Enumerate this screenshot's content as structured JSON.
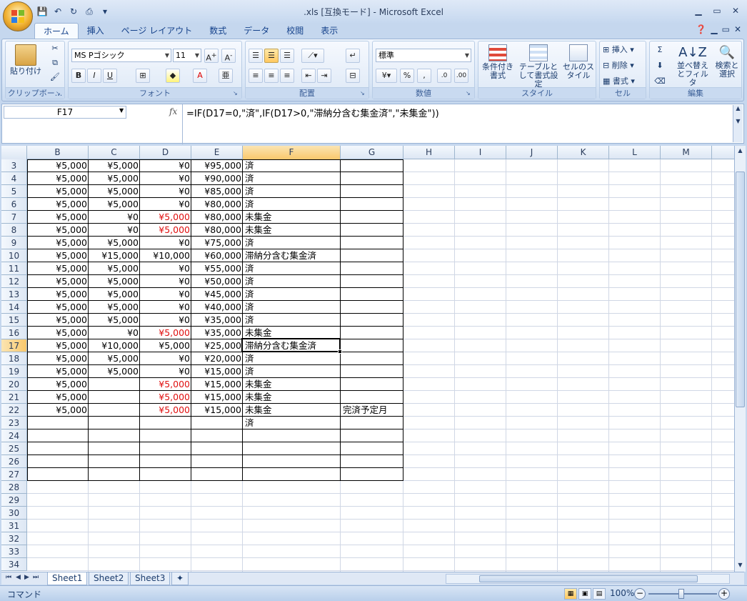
{
  "app": {
    "title": ".xls [互換モード] - Microsoft Excel"
  },
  "ribbon_tabs": [
    "ホーム",
    "挿入",
    "ページ レイアウト",
    "数式",
    "データ",
    "校閲",
    "表示"
  ],
  "groups": {
    "clipboard": {
      "label": "クリップボー...",
      "paste": "貼り付け"
    },
    "font": {
      "label": "フォント",
      "font_name": "MS Pゴシック",
      "font_size": "11"
    },
    "alignment": {
      "label": "配置"
    },
    "number": {
      "label": "数値",
      "format": "標準"
    },
    "style": {
      "label": "スタイル",
      "conditional": "条件付き書式",
      "table": "テーブルとして書式設定",
      "cell_style": "セルのスタイル"
    },
    "cells": {
      "label": "セル",
      "insert": "挿入",
      "delete": "削除",
      "format": "書式"
    },
    "editing": {
      "label": "編集",
      "sort": "並べ替えとフィルタ",
      "find": "検索と選択"
    }
  },
  "formula_bar": {
    "name_box": "F17",
    "formula": "=IF(D17=0,\"済\",IF(D17>0,\"滞納分含む集金済\",\"未集金\"))"
  },
  "columns": [
    "B",
    "C",
    "D",
    "E",
    "F",
    "G",
    "H",
    "I",
    "J",
    "K",
    "L",
    "M"
  ],
  "rows": [
    3,
    4,
    5,
    6,
    7,
    8,
    9,
    10,
    11,
    12,
    13,
    14,
    15,
    16,
    17,
    18,
    19,
    20,
    21,
    22,
    23,
    24,
    25,
    26,
    27,
    28,
    29,
    30,
    31,
    32,
    33,
    34
  ],
  "table": [
    {
      "B": "¥5,000",
      "C": "¥5,000",
      "D": "¥0",
      "E": "¥95,000",
      "F": "済",
      "G": ""
    },
    {
      "B": "¥5,000",
      "C": "¥5,000",
      "D": "¥0",
      "E": "¥90,000",
      "F": "済",
      "G": ""
    },
    {
      "B": "¥5,000",
      "C": "¥5,000",
      "D": "¥0",
      "E": "¥85,000",
      "F": "済",
      "G": ""
    },
    {
      "B": "¥5,000",
      "C": "¥5,000",
      "D": "¥0",
      "E": "¥80,000",
      "F": "済",
      "G": ""
    },
    {
      "B": "¥5,000",
      "C": "¥0",
      "D": "¥5,000",
      "E": "¥80,000",
      "F": "未集金",
      "G": "",
      "Dred": true
    },
    {
      "B": "¥5,000",
      "C": "¥0",
      "D": "¥5,000",
      "E": "¥80,000",
      "F": "未集金",
      "G": "",
      "Dred": true
    },
    {
      "B": "¥5,000",
      "C": "¥5,000",
      "D": "¥0",
      "E": "¥75,000",
      "F": "済",
      "G": ""
    },
    {
      "B": "¥5,000",
      "C": "¥15,000",
      "D": "¥10,000",
      "E": "¥60,000",
      "F": "滞納分含む集金済",
      "G": ""
    },
    {
      "B": "¥5,000",
      "C": "¥5,000",
      "D": "¥0",
      "E": "¥55,000",
      "F": "済",
      "G": ""
    },
    {
      "B": "¥5,000",
      "C": "¥5,000",
      "D": "¥0",
      "E": "¥50,000",
      "F": "済",
      "G": ""
    },
    {
      "B": "¥5,000",
      "C": "¥5,000",
      "D": "¥0",
      "E": "¥45,000",
      "F": "済",
      "G": ""
    },
    {
      "B": "¥5,000",
      "C": "¥5,000",
      "D": "¥0",
      "E": "¥40,000",
      "F": "済",
      "G": ""
    },
    {
      "B": "¥5,000",
      "C": "¥5,000",
      "D": "¥0",
      "E": "¥35,000",
      "F": "済",
      "G": ""
    },
    {
      "B": "¥5,000",
      "C": "¥0",
      "D": "¥5,000",
      "E": "¥35,000",
      "F": "未集金",
      "G": "",
      "Dred": true
    },
    {
      "B": "¥5,000",
      "C": "¥10,000",
      "D": "¥5,000",
      "E": "¥25,000",
      "F": "滞納分含む集金済",
      "G": ""
    },
    {
      "B": "¥5,000",
      "C": "¥5,000",
      "D": "¥0",
      "E": "¥20,000",
      "F": "済",
      "G": ""
    },
    {
      "B": "¥5,000",
      "C": "¥5,000",
      "D": "¥0",
      "E": "¥15,000",
      "F": "済",
      "G": ""
    },
    {
      "B": "¥5,000",
      "C": "",
      "D": "¥5,000",
      "E": "¥15,000",
      "F": "未集金",
      "G": "",
      "Dred": true
    },
    {
      "B": "¥5,000",
      "C": "",
      "D": "¥5,000",
      "E": "¥15,000",
      "F": "未集金",
      "G": "",
      "Dred": true
    },
    {
      "B": "¥5,000",
      "C": "",
      "D": "¥5,000",
      "E": "¥15,000",
      "F": "未集金",
      "G": "完済予定月",
      "Dred": true
    },
    {
      "B": "",
      "C": "",
      "D": "",
      "E": "",
      "F": "済",
      "G": ""
    }
  ],
  "sheets": [
    "Sheet1",
    "Sheet2",
    "Sheet3"
  ],
  "status": {
    "mode": "コマンド",
    "zoom": "100%"
  },
  "colors": {
    "accent": "#15428b",
    "negative": "#e01010",
    "selected_header": "#f9c86c"
  }
}
